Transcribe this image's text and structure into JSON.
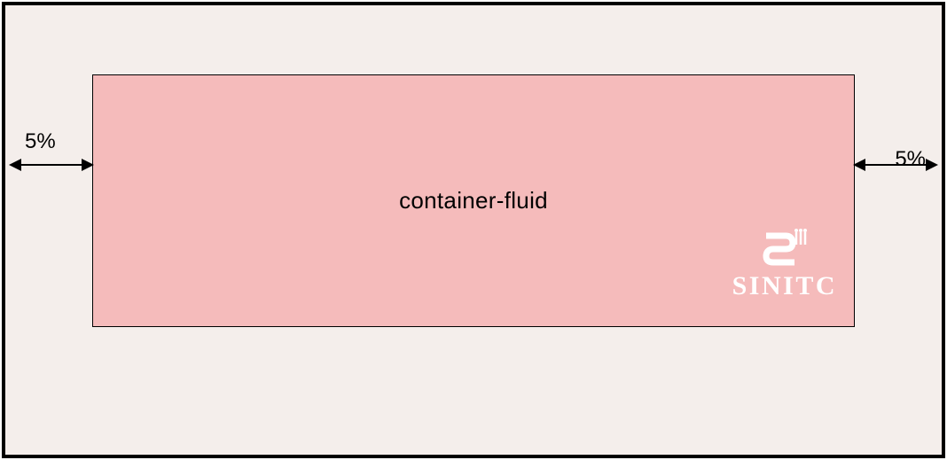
{
  "margin_left_label": "5%",
  "margin_right_label": "5%",
  "container_label": "container-fluid",
  "watermark": {
    "text": "SINITC"
  }
}
